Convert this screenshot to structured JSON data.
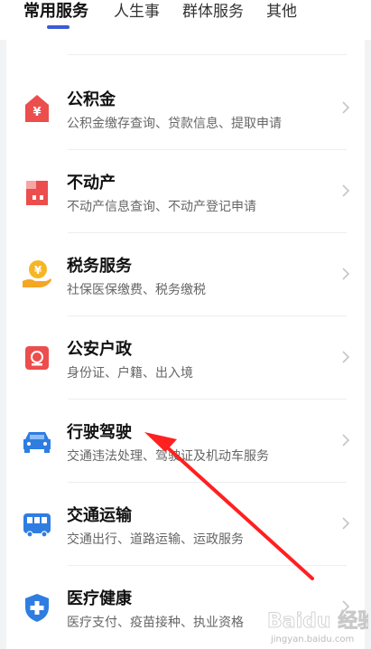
{
  "tabs": [
    {
      "label": "常用服务"
    },
    {
      "label": "人生事"
    },
    {
      "label": "群体服务"
    },
    {
      "label": "其他"
    }
  ],
  "services": [
    {
      "title": "公积金",
      "subtitle": "公积金缴存查询、贷款信息、提取申请",
      "icon": "housing-fund-icon",
      "color": "#ec4d4d"
    },
    {
      "title": "不动产",
      "subtitle": "不动产信息查询、不动产登记申请",
      "icon": "building-icon",
      "color": "#ec4d4d"
    },
    {
      "title": "税务服务",
      "subtitle": "社保医保缴费、税务缴税",
      "icon": "tax-hand-icon",
      "color": "#f5a623"
    },
    {
      "title": "公安户政",
      "subtitle": "身份证、户籍、出入境",
      "icon": "police-badge-icon",
      "color": "#ec4d4d"
    },
    {
      "title": "行驶驾驶",
      "subtitle": "交通违法处理、驾驶证及机动车服务",
      "icon": "car-icon",
      "color": "#2f7de1"
    },
    {
      "title": "交通运输",
      "subtitle": "交通出行、道路运输、运政服务",
      "icon": "bus-icon",
      "color": "#2f7de1"
    },
    {
      "title": "医疗健康",
      "subtitle": "医疗支付、疫苗接种、执业资格",
      "icon": "medical-shield-icon",
      "color": "#2f7de1"
    }
  ],
  "watermark": {
    "text": "jingyan.baidu.com",
    "brand": "Baidu 经验"
  }
}
